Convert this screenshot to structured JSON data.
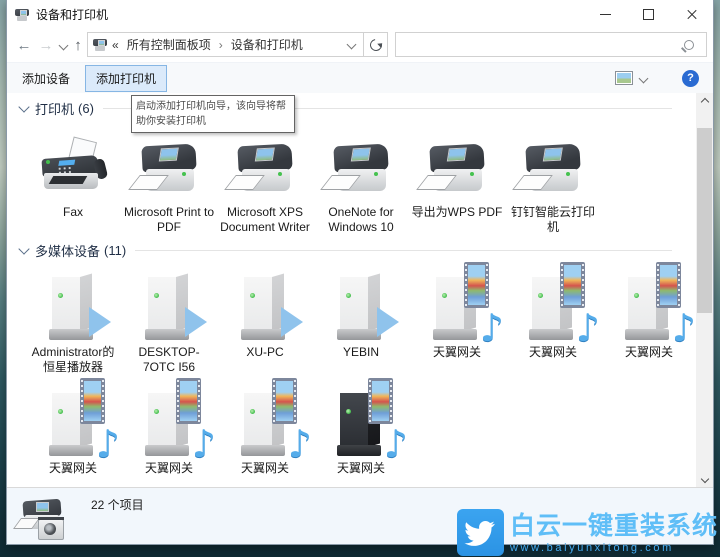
{
  "window": {
    "title": "设备和打印机"
  },
  "navbar": {
    "overflow": "«",
    "crumb_root": "所有控制面板项",
    "sep": "›",
    "crumb_current": "设备和打印机",
    "back": "←",
    "forward": "→",
    "up": "↑",
    "search_value": ""
  },
  "toolbar": {
    "add_device": "添加设备",
    "add_printer": "添加打印机",
    "help": "?"
  },
  "tooltip": {
    "text": "启动添加打印机向导，该向导将帮助你安装打印机"
  },
  "sections": [
    {
      "title": "打印机",
      "count": "(6)",
      "rows": [
        [
          {
            "label": "Fax",
            "icon": "fax"
          },
          {
            "label": "Microsoft Print to PDF",
            "icon": "printer"
          },
          {
            "label": "Microsoft XPS Document Writer",
            "icon": "printer"
          },
          {
            "label": "OneNote for Windows 10",
            "icon": "printer"
          },
          {
            "label": "导出为WPS PDF",
            "icon": "printer"
          },
          {
            "label": "钉钉智能云打印机",
            "icon": "printer"
          }
        ]
      ]
    },
    {
      "title": "多媒体设备",
      "count": "(11)",
      "rows": [
        [
          {
            "label": "Administrator的恒星播放器",
            "icon": "tower-play"
          },
          {
            "label": "DESKTOP-7OTC I56",
            "icon": "tower-play"
          },
          {
            "label": "XU-PC",
            "icon": "tower-play"
          },
          {
            "label": "YEBIN",
            "icon": "tower-play"
          },
          {
            "label": "天翼网关",
            "icon": "tower-media"
          },
          {
            "label": "天翼网关",
            "icon": "tower-media"
          },
          {
            "label": "天翼网关",
            "icon": "tower-media"
          }
        ],
        [
          {
            "label": "天翼网关",
            "icon": "tower-media"
          },
          {
            "label": "天翼网关",
            "icon": "tower-media"
          },
          {
            "label": "天翼网关",
            "icon": "tower-media"
          },
          {
            "label": "天翼网关",
            "icon": "tower-media-dark"
          }
        ]
      ]
    }
  ],
  "statusbar": {
    "items_count": "22 个项目"
  },
  "watermark": {
    "title": "白云一键重装系统",
    "url": "www.baiyunxitong.com"
  },
  "icons": {
    "note": "♪"
  },
  "colors": {
    "accent_blue": "#3aa0e8",
    "button_highlight": "#dbeafa",
    "button_border": "#86b6e4",
    "help_blue": "#2a6bd2",
    "led_green": "#3fbb49",
    "play_blue": "#8fc3ec"
  }
}
